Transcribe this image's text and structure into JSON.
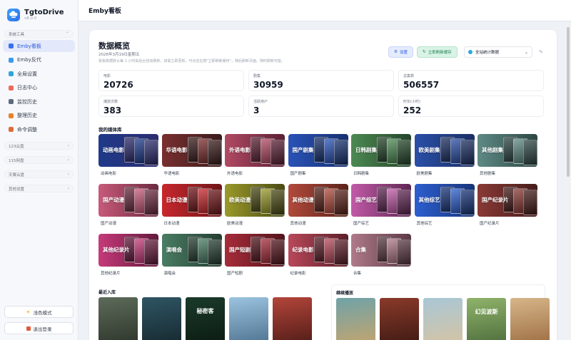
{
  "app": {
    "name": "TgtoDrive",
    "version": "v8.0.0"
  },
  "sidebar": {
    "group_main": "系统工具",
    "items": [
      {
        "label": "Emby看板",
        "icon": "grid-icon",
        "color": "#3a6ff0",
        "active": true
      },
      {
        "label": "Emby反代",
        "icon": "proxy-icon",
        "color": "#3a9bf0"
      },
      {
        "label": "全局设置",
        "icon": "globe-icon",
        "color": "#2fa6d8"
      },
      {
        "label": "日志中心",
        "icon": "log-icon",
        "color": "#ef6a5b"
      },
      {
        "label": "监控历史",
        "icon": "monitor-icon",
        "color": "#5b6b82"
      },
      {
        "label": "整理历史",
        "icon": "sort-icon",
        "color": "#e8812a"
      },
      {
        "label": "命令调整",
        "icon": "command-icon",
        "color": "#e06b3b"
      }
    ],
    "groups": [
      "123云盘",
      "115网盘",
      "天翼云盘",
      "其他设置"
    ],
    "theme_button": "浅色模式",
    "logout_button": "退出登录"
  },
  "header": {
    "title": "Emby看板"
  },
  "overview": {
    "title": "数据概览",
    "date": "2026年3月19日星期五",
    "note": "看板数据默认每 1 小时由后台自动刷新，如需立即更新，可点击右侧\"立即刷新缓存\"，随后刷新页面。随时刷新可能。",
    "reset_label": "设置",
    "refresh_label": "立即刷新缓存",
    "scope_select": "全站统计数据",
    "stats": [
      {
        "label": "电影",
        "value": "20726"
      },
      {
        "label": "剧集",
        "value": "30959"
      },
      {
        "label": "总集数",
        "value": "506557"
      },
      {
        "label": "播放次数",
        "value": "383"
      },
      {
        "label": "活跃用户",
        "value": "3"
      },
      {
        "label": "时长(小时)",
        "value": "252"
      }
    ]
  },
  "libraries": {
    "title": "我的媒体库",
    "items": [
      {
        "name": "动画电影",
        "overlay": "动画电影",
        "c1": "#1e3a8a",
        "c2": "#2c2c6e"
      },
      {
        "name": "华语电影",
        "overlay": "华语电影",
        "c1": "#7a2f2f",
        "c2": "#3a1c1c"
      },
      {
        "name": "外语电影",
        "overlay": "外语电影",
        "c1": "#b24a63",
        "c2": "#5a2035"
      },
      {
        "name": "国产剧集",
        "overlay": "国产剧集",
        "c1": "#2a52b8",
        "c2": "#16306e"
      },
      {
        "name": "日韩剧集",
        "overlay": "日韩剧集",
        "c1": "#4d8a53",
        "c2": "#24452a"
      },
      {
        "name": "欧美剧集",
        "overlay": "欧美剧集",
        "c1": "#2a4fa8",
        "c2": "#1b2f63"
      },
      {
        "name": "其他剧集",
        "overlay": "其他剧集",
        "c1": "#5f8a85",
        "c2": "#2d4744"
      },
      {
        "name": "国产动漫",
        "overlay": "国产动漫",
        "c1": "#c85a7a",
        "c2": "#6a2a40"
      },
      {
        "name": "日本动漫",
        "overlay": "日本动漫",
        "c1": "#c8282d",
        "c2": "#6e1518"
      },
      {
        "name": "欧美动漫",
        "overlay": "欧美动漫",
        "c1": "#9a9a2a",
        "c2": "#4a4a14"
      },
      {
        "name": "其他动漫",
        "overlay": "其他动漫",
        "c1": "#b24a3c",
        "c2": "#5a2219"
      },
      {
        "name": "国产综艺",
        "overlay": "国产综艺",
        "c1": "#c25aa8",
        "c2": "#5e2752"
      },
      {
        "name": "其他综艺",
        "overlay": "其他综艺",
        "c1": "#2d5fd0",
        "c2": "#173478"
      },
      {
        "name": "国产纪录片",
        "overlay": "国产纪录片",
        "c1": "#8a3a36",
        "c2": "#451c1a"
      },
      {
        "name": "其他纪录片",
        "overlay": "其他纪录片",
        "c1": "#c63a7a",
        "c2": "#63193c"
      },
      {
        "name": "演唱会",
        "overlay": "演唱会",
        "c1": "#4a7d64",
        "c2": "#243e31"
      },
      {
        "name": "国产短剧",
        "overlay": "国产短剧",
        "c1": "#a82c3a",
        "c2": "#52141c"
      },
      {
        "name": "纪录电影",
        "overlay": "纪录电影",
        "c1": "#b9485a",
        "c2": "#5b1f29"
      },
      {
        "name": "合集",
        "overlay": "合集",
        "c1": "#b07a8a",
        "c2": "#5a3a44"
      }
    ]
  },
  "recent": {
    "title": "最近入库",
    "covers": [
      {
        "text": "",
        "c1": "#5d6b5a",
        "c2": "#2b3328"
      },
      {
        "text": "",
        "c1": "#2e5563",
        "c2": "#16272e"
      },
      {
        "text": "秘密客",
        "c1": "#1a3a2a",
        "c2": "#0b1a12"
      },
      {
        "text": "",
        "c1": "#9bc3e0",
        "c2": "#4b6f8c"
      },
      {
        "text": "",
        "c1": "#b3453a",
        "c2": "#4d1b16"
      }
    ]
  },
  "continue": {
    "title": "继续播放",
    "covers": [
      {
        "text": "",
        "c1": "#6fa3a8",
        "c2": "#c9a46b"
      },
      {
        "text": "",
        "c1": "#8a3a2a",
        "c2": "#3a1812"
      },
      {
        "text": "",
        "c1": "#a9c7d6",
        "c2": "#d8c3a0"
      },
      {
        "text": "幻见波斯",
        "c1": "#8fb36a",
        "c2": "#4a6a3a"
      },
      {
        "text": "",
        "c1": "#d6b68a",
        "c2": "#9a6a3e"
      }
    ]
  }
}
